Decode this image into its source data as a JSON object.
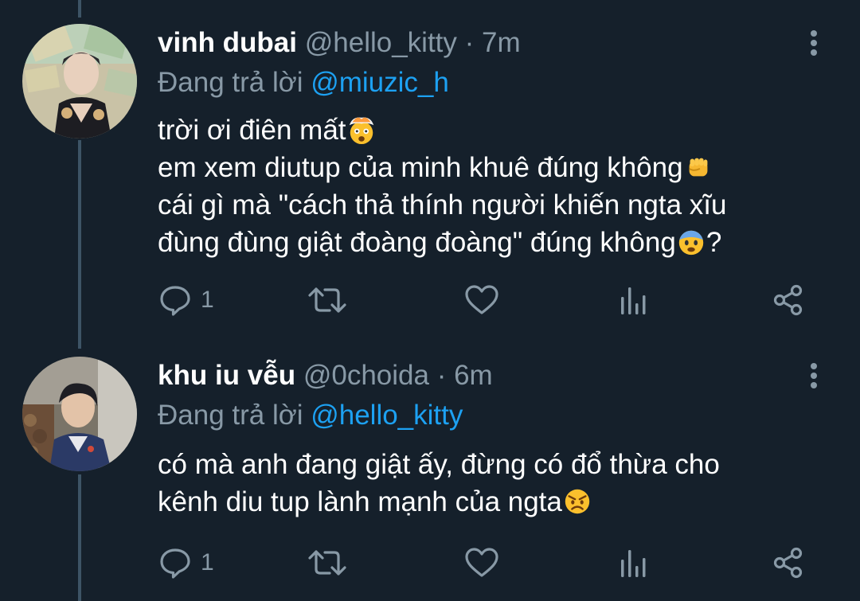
{
  "tweets": [
    {
      "display_name": "vinh dubai",
      "handle": "@hello_kitty",
      "separator": "·",
      "time": "7m",
      "replying_prefix": "Đang trả lời",
      "replying_to": "@miuzic_h",
      "lines": [
        "trời ơi điên mất",
        "em xem diutup của minh khuê đúng không",
        "cái gì mà \"cách thả thính người khiến ngta xĩu",
        "đùng đùng giật đoàng đoàng\" đúng không",
        "?"
      ],
      "emojis": [
        "exploding-head",
        "oncoming-fist",
        "fearful-face"
      ],
      "reply_count": "1"
    },
    {
      "display_name": "khu iu vễu",
      "handle": "@0choida",
      "separator": "·",
      "time": "6m",
      "replying_prefix": "Đang trả lời",
      "replying_to": "@hello_kitty",
      "lines": [
        "có mà anh đang giật ấy, đừng có đổ thừa cho",
        "kênh diu tup lành mạnh của ngta"
      ],
      "emojis": [
        "angry-face"
      ],
      "reply_count": "1"
    }
  ],
  "icons": {
    "reply": "reply-icon",
    "retweet": "retweet-icon",
    "like": "heart-icon",
    "analytics": "analytics-icon",
    "share": "share-icon",
    "more": "more-vertical-icon"
  },
  "colors": {
    "background": "#15202b",
    "primary_text": "#ffffff",
    "secondary_text": "#8899a6",
    "link": "#1da1f2",
    "thread_line": "#3d5466"
  }
}
